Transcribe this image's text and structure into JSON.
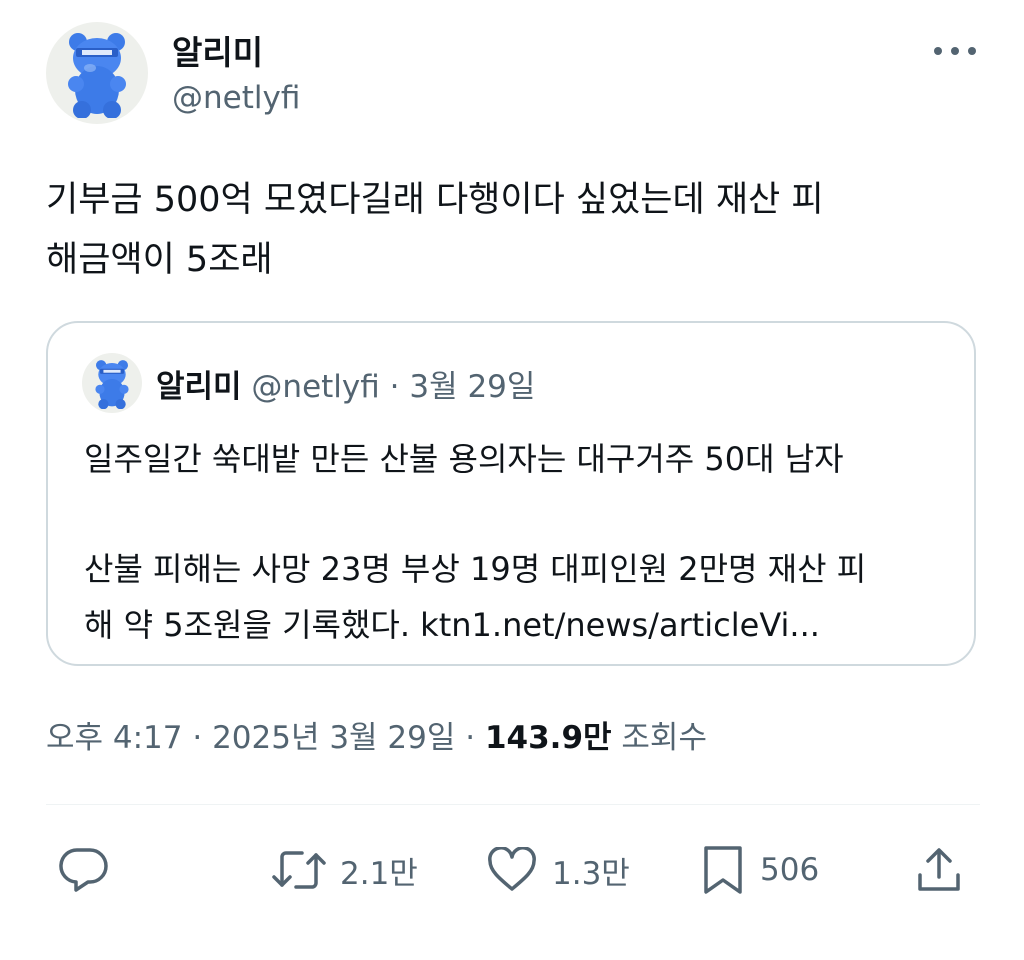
{
  "tweet": {
    "author_name": "알리미",
    "author_handle": "@netlyfi",
    "text_lines": [
      "기부금 500억 모였다길래 다행이다 싶었는데 재산 피",
      "해금액이 5조래"
    ]
  },
  "quote": {
    "author_name": "알리미",
    "meta": "@netlyfi · 3월 29일",
    "line1": "일주일간 쑥대밭 만든 산불 용의자는 대구거주 50대 남자",
    "line2": "산불 피해는 사망 23명 부상 19명 대피인원 2만명 재산 피",
    "line3": "해 약 5조원을 기록했다. ktn1.net/news/articleVi..."
  },
  "timestamp": {
    "time_date": "오후 4:17 · 2025년 3월 29일 · ",
    "views_count": "143.9만",
    "views_label": " 조회수"
  },
  "actions": {
    "reply_count": "",
    "retweet_count": "2.1만",
    "like_count": "1.3만",
    "bookmark_count": "506"
  },
  "icons": [
    "avatar-gummy-bear",
    "more-icon",
    "reply-icon",
    "retweet-icon",
    "like-icon",
    "bookmark-icon",
    "share-icon"
  ],
  "colors": {
    "text_primary": "#0f1419",
    "text_secondary": "#536471",
    "border": "#cfd9de",
    "avatar_bear": "#3d7be8"
  }
}
